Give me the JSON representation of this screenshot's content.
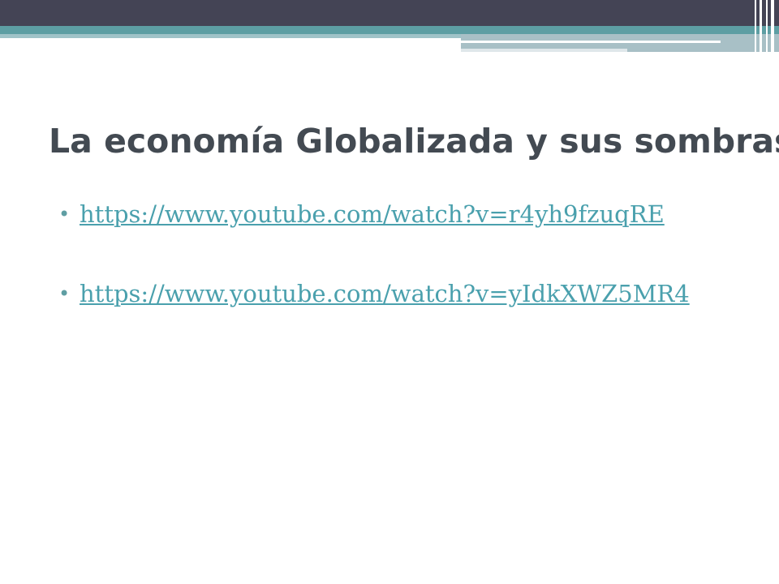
{
  "slide": {
    "title": "La economía Globalizada y sus sombras",
    "bullet_glyph": "•",
    "links": [
      {
        "text": "https://www.youtube.com/watch?v=r4yh9fzuqRE"
      },
      {
        "text": "https://www.youtube.com/watch?v=yIdkXWZ5MR4"
      }
    ]
  },
  "colors": {
    "header_dark": "#444455",
    "header_teal": "#5d9ea3",
    "title_text": "#434a52",
    "link": "#4aa0ad",
    "bullet": "#5f9ea3"
  }
}
